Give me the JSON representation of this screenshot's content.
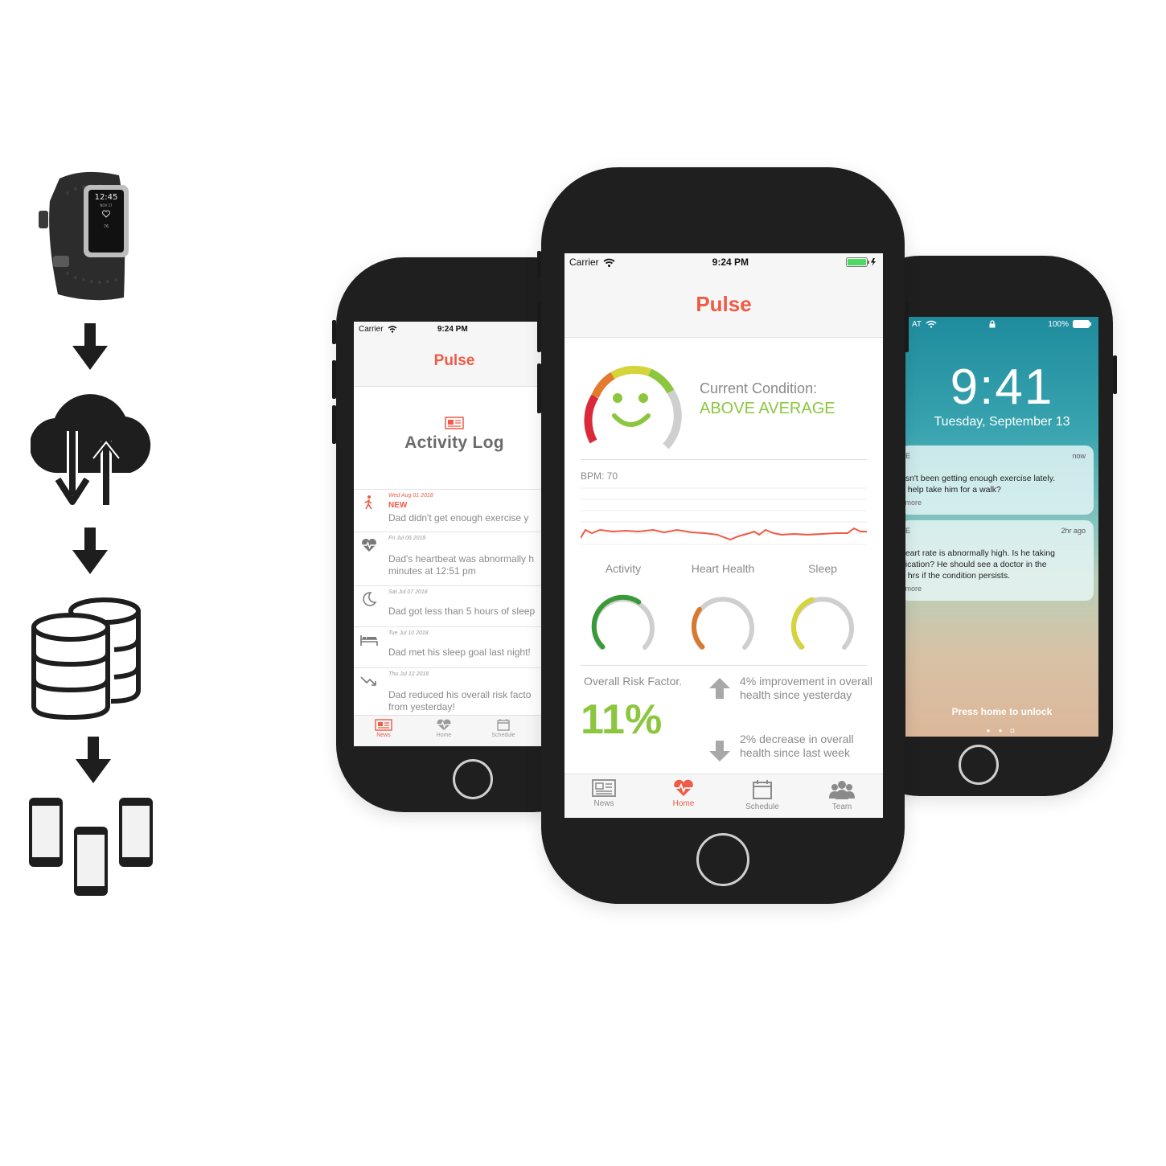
{
  "pipeline": {
    "tracker_time": "12:45",
    "tracker_date": "NOV 27",
    "tracker_steps": "76"
  },
  "left_phone": {
    "status": {
      "carrier": "Carrier",
      "time": "9:24 PM"
    },
    "title": "Pulse",
    "section_title": "Activity Log",
    "entries": [
      {
        "icon": "walking-icon",
        "date": "Wed Aug 01 2018",
        "badge": "NEW",
        "text": "Dad didn't get enough exercise y",
        "text2": ""
      },
      {
        "icon": "heartbeat-icon",
        "date": "Fri Jul 06 2018",
        "badge": "",
        "text": "Dad's heartbeat was abnormally h",
        "text2": "minutes at 12:51 pm"
      },
      {
        "icon": "moon-icon",
        "date": "Sat Jul 07 2018",
        "badge": "",
        "text": "Dad got less than 5 hours of sleep",
        "text2": ""
      },
      {
        "icon": "bed-icon",
        "date": "Tue Jul 10 2018",
        "badge": "",
        "text": "Dad met his sleep goal last night!",
        "text2": ""
      },
      {
        "icon": "trend-down-icon",
        "date": "Thu Jul 12 2018",
        "badge": "",
        "text": "Dad reduced his overall risk facto",
        "text2": "from yesterday!"
      }
    ],
    "tabs": [
      {
        "label": "News"
      },
      {
        "label": "Home"
      },
      {
        "label": "Schedule"
      }
    ]
  },
  "center_phone": {
    "status": {
      "carrier": "Carrier",
      "time": "9:24 PM"
    },
    "title": "Pulse",
    "condition_label": "Current Condition:",
    "condition_value": "ABOVE AVERAGE",
    "bpm_label": "BPM: 70",
    "gauges": [
      {
        "label": "Activity",
        "color": "#3a9a3a",
        "fraction": 0.62
      },
      {
        "label": "Heart Health",
        "color": "#d8792f",
        "fraction": 0.3
      },
      {
        "label": "Sleep",
        "color": "#d5d43a",
        "fraction": 0.42
      }
    ],
    "risk_label": "Overall Risk Factor.",
    "risk_value": "11%",
    "trends": [
      {
        "direction": "up",
        "text": "4% improvement in overall health since yesterday"
      },
      {
        "direction": "down",
        "text": "2% decrease in overall health since last week"
      }
    ],
    "tabs": [
      {
        "label": "News"
      },
      {
        "label": "Home"
      },
      {
        "label": "Schedule"
      },
      {
        "label": "Team"
      }
    ],
    "accent": "#ef5b47",
    "good": "#8cc63f"
  },
  "right_phone": {
    "status": {
      "carrier": "AT",
      "battery": "100%"
    },
    "time": "9:41",
    "date": "Tuesday, September 13",
    "notifications": [
      {
        "app": "SE",
        "when": "now",
        "lines": [
          "asn't been getting enough exercise lately.",
          "u help take him for a walk?"
        ],
        "more": "r more"
      },
      {
        "app": "SE",
        "when": "2hr ago",
        "lines": [
          "heart rate is abnormally high. Is he taking",
          "dication? He should see a doctor in the",
          "8 hrs if the condition persists."
        ],
        "more": "r more"
      }
    ],
    "unlock_hint": "Press home to unlock"
  }
}
